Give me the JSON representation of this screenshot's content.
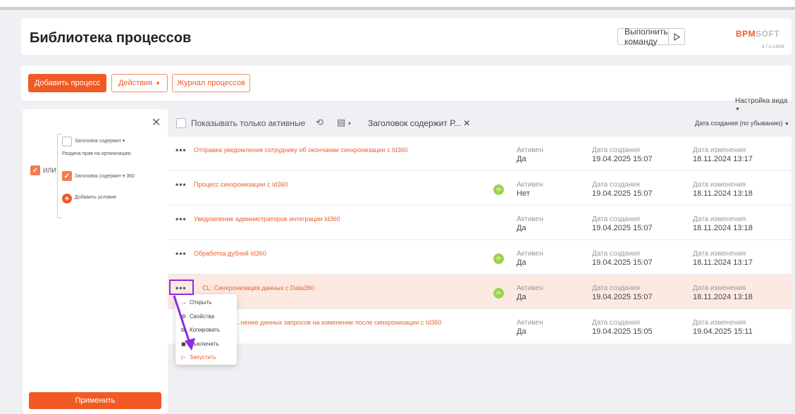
{
  "header": {
    "title": "Библиотека процессов",
    "command_label": "Выполнить команду",
    "logo_brand": "BPM",
    "logo_suffix": "SOFT",
    "version": "8.7.0.14838"
  },
  "toolbar": {
    "add_process": "Добавить процесс",
    "actions": "Действия",
    "journal": "Журнал процессов",
    "view_settings": "Настройка вида"
  },
  "filter": {
    "group_operator": "ИЛИ",
    "cond1_label": "Заголовок содержит",
    "cond1_value": "Раздача прав на организацию",
    "cond2_label": "Заголовок содержит",
    "cond2_value": "360",
    "add_condition": "Добавить условие",
    "apply": "Применить"
  },
  "controls": {
    "only_active": "Показывать только активные",
    "filter_tag": "Заголовок содержит Р...",
    "sort": "Дата создания (по убыванию)"
  },
  "labels": {
    "active": "Активен",
    "created": "Дата создания",
    "modified": "Дата изменения"
  },
  "processes": [
    {
      "name": "Отправка уведомления сотруднику об окончании синхронизации с Id360",
      "active": "Да",
      "created": "19.04.2025 15:07",
      "modified": "18.11.2024 13:17",
      "badge": false
    },
    {
      "name": "Процесс синхронизации с Id360",
      "active": "Нет",
      "created": "19.04.2025 15:07",
      "modified": "18.11.2024 13:18",
      "badge": true
    },
    {
      "name": "Уведомление администраторов интеграции Id360",
      "active": "Да",
      "created": "19.04.2025 15:07",
      "modified": "18.11.2024 13:18",
      "badge": false
    },
    {
      "name": "Обработка дублей Id360",
      "active": "Да",
      "created": "19.04.2025 15:07",
      "modified": "18.11.2024 13:17",
      "badge": true
    },
    {
      "name": "CL: Синхронизация данных с Data360",
      "active": "Да",
      "created": "19.04.2025 15:07",
      "modified": "18.11.2024 13:18",
      "badge": true
    },
    {
      "name": "...нение данных запросов на изменение после синхронизации с Id360",
      "active": "Да",
      "created": "19.04.2025 15:05",
      "modified": "19.04.2025 15:11",
      "badge": false
    }
  ],
  "context_menu": {
    "open": "Открыть",
    "properties": "Свойства",
    "copy": "Копировать",
    "disable": "Выключить",
    "run": "Запустить"
  },
  "colors": {
    "accent": "#f15a24",
    "badge": "#9bd44a",
    "highlight": "#8e2be2"
  }
}
